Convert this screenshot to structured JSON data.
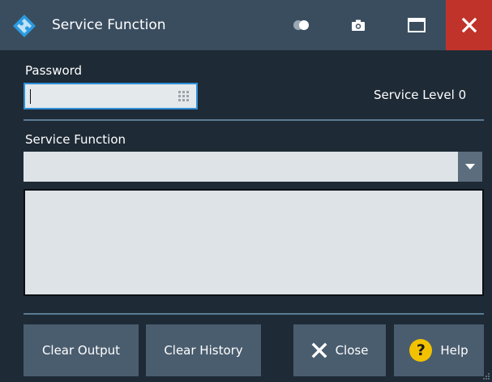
{
  "window": {
    "title": "Service Function"
  },
  "titlebar": {
    "toggle_icon": "toggle-icon",
    "camera_icon": "camera-icon",
    "maximize_icon": "maximize-icon",
    "close_icon": "close-icon",
    "close_color": "#c0332b"
  },
  "password": {
    "label": "Password",
    "value": "",
    "keypad_icon": "keypad-icon"
  },
  "service_level": {
    "text": "Service Level 0"
  },
  "service_function": {
    "label": "Service Function",
    "selected": "",
    "dropdown_icon": "chevron-down-icon"
  },
  "output": {
    "text": ""
  },
  "buttons": {
    "clear_output": "Clear Output",
    "clear_history": "Clear History",
    "close": "Close",
    "help": "Help",
    "help_glyph": "?"
  },
  "colors": {
    "accent": "#2f8fd8",
    "background": "#1e2a35",
    "titlebar": "#3a4d5f",
    "button": "#4a5d6f",
    "help_icon": "#f2c200"
  }
}
